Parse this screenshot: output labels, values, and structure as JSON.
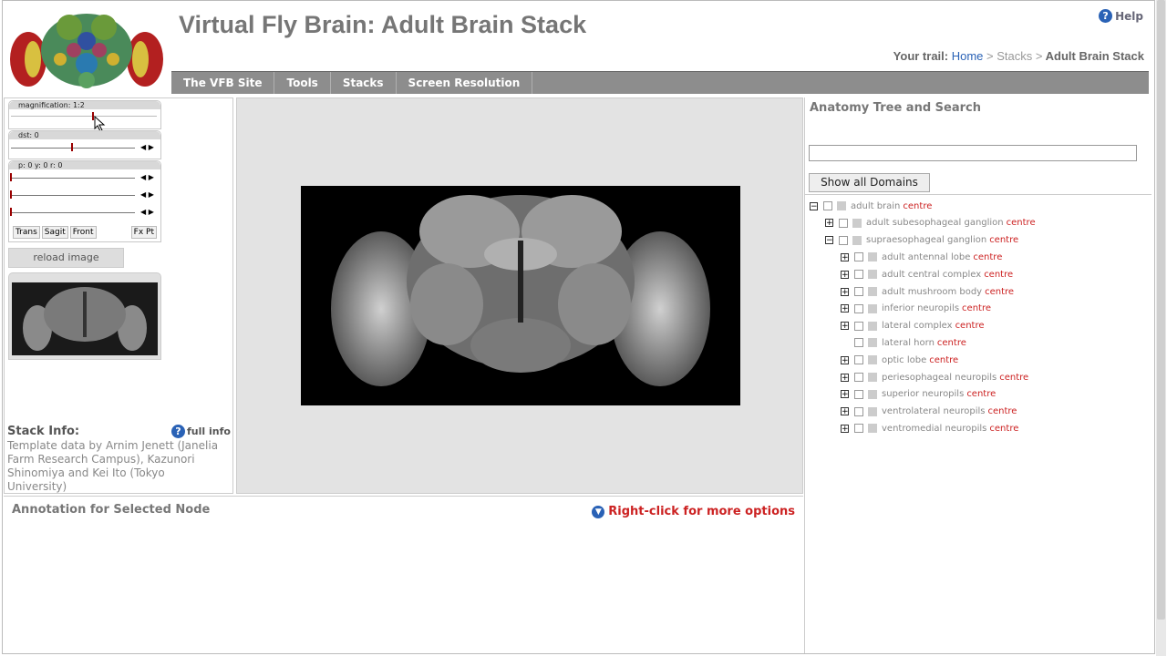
{
  "header": {
    "title": "Virtual Fly Brain: Adult Brain Stack",
    "help_label": "Help",
    "trail_label": "Your trail:",
    "trail_home": "Home",
    "trail_sep1": ">",
    "trail_stacks": "Stacks",
    "trail_sep2": ">",
    "trail_current": "Adult Brain Stack"
  },
  "nav": [
    "The VFB Site",
    "Tools",
    "Stacks",
    "Screen Resolution"
  ],
  "controls": {
    "magnification_label": "magnification: 1:2",
    "dst_label": "dst: 0",
    "pyr_label": "p: 0   y: 0   r: 0",
    "arrows": "◀ ▶",
    "view_buttons": [
      "Trans",
      "Sagit",
      "Front",
      "Fx Pt"
    ],
    "reload_label": "reload image"
  },
  "stack_info": {
    "heading": "Stack Info:",
    "full_info_label": "full info",
    "text": "Template data by Arnim Jenett (Janelia Farm Research Campus), Kazunori Shinomiya and Kei Ito (Tokyo University)"
  },
  "anatomy": {
    "title": "Anatomy Tree and Search",
    "show_all_label": "Show all Domains",
    "centre_label": "centre",
    "tree": [
      {
        "label": "adult brain",
        "level": 0,
        "toggle": "−"
      },
      {
        "label": "adult subesophageal ganglion",
        "level": 1,
        "toggle": "+"
      },
      {
        "label": "supraesophageal ganglion",
        "level": 1,
        "toggle": "−"
      },
      {
        "label": "adult antennal lobe",
        "level": 2,
        "toggle": "+"
      },
      {
        "label": "adult central complex",
        "level": 2,
        "toggle": "+"
      },
      {
        "label": "adult mushroom body",
        "level": 2,
        "toggle": "+"
      },
      {
        "label": "inferior neuropils",
        "level": 2,
        "toggle": "+"
      },
      {
        "label": "lateral complex",
        "level": 2,
        "toggle": "+"
      },
      {
        "label": "lateral horn",
        "level": 2,
        "toggle": ""
      },
      {
        "label": "optic lobe",
        "level": 2,
        "toggle": "+"
      },
      {
        "label": "periesophageal neuropils",
        "level": 2,
        "toggle": "+"
      },
      {
        "label": "superior neuropils",
        "level": 2,
        "toggle": "+"
      },
      {
        "label": "ventrolateral neuropils",
        "level": 2,
        "toggle": "+"
      },
      {
        "label": "ventromedial neuropils",
        "level": 2,
        "toggle": "+"
      }
    ]
  },
  "annotation": {
    "heading": "Annotation for Selected Node",
    "right_click_label": "Right-click for more options"
  },
  "colors": {
    "accent_red": "#cc2222",
    "link_blue": "#2a62b6",
    "nav_gray": "#8d8d8d"
  }
}
